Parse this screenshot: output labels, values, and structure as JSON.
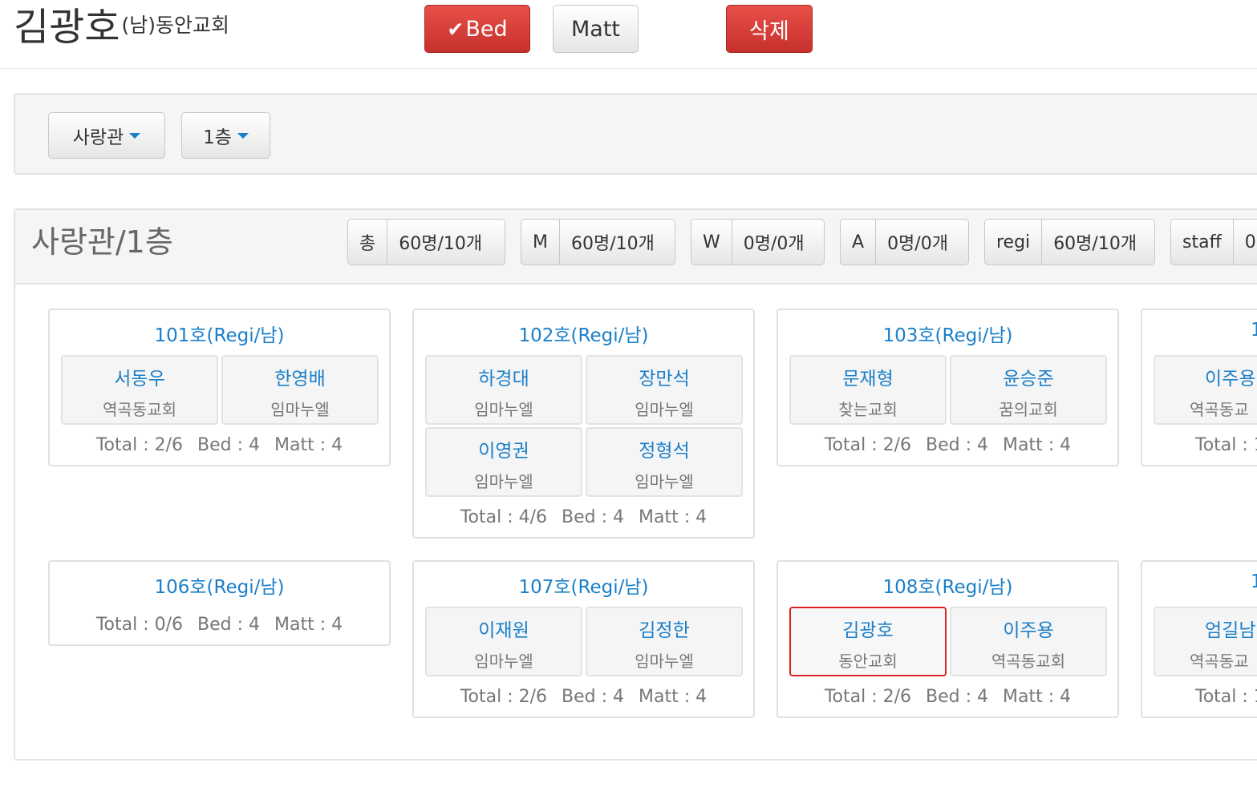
{
  "header": {
    "name": "김광호",
    "sub": "(남)동안교회",
    "bed_button": "Bed",
    "matt_button": "Matt",
    "delete_button": "삭제"
  },
  "filters": {
    "building": "사랑관",
    "floor": "1층"
  },
  "panel": {
    "title": "사랑관/1층",
    "stats": [
      {
        "key": "총",
        "value": "60명/10개"
      },
      {
        "key": "M",
        "value": "60명/10개"
      },
      {
        "key": "W",
        "value": "0명/0개"
      },
      {
        "key": "A",
        "value": "0명/0개"
      },
      {
        "key": "regi",
        "value": "60명/10개"
      },
      {
        "key": "staff",
        "value": "0"
      }
    ]
  },
  "rooms": [
    {
      "title": "101호(Regi/남)",
      "people": [
        {
          "name": "서동우",
          "church": "역곡동교회"
        },
        {
          "name": "한영배",
          "church": "임마누엘"
        }
      ],
      "total": "Total : 2/6",
      "bed": "Bed : 4",
      "matt": "Matt : 4"
    },
    {
      "title": "102호(Regi/남)",
      "people": [
        {
          "name": "하경대",
          "church": "임마누엘"
        },
        {
          "name": "장만석",
          "church": "임마누엘"
        },
        {
          "name": "이영권",
          "church": "임마누엘"
        },
        {
          "name": "정형석",
          "church": "임마누엘"
        }
      ],
      "total": "Total : 4/6",
      "bed": "Bed : 4",
      "matt": "Matt : 4"
    },
    {
      "title": "103호(Regi/남)",
      "people": [
        {
          "name": "문재형",
          "church": "찾는교회"
        },
        {
          "name": "윤승준",
          "church": "꿈의교회"
        }
      ],
      "total": "Total : 2/6",
      "bed": "Bed : 4",
      "matt": "Matt : 4"
    },
    {
      "title": "1",
      "people": [
        {
          "name": "이주용",
          "church": "역곡동교"
        }
      ],
      "total": "Total : 1",
      "bed": "",
      "matt": ""
    },
    {
      "title": "106호(Regi/남)",
      "people": [],
      "total": "Total : 0/6",
      "bed": "Bed : 4",
      "matt": "Matt : 4"
    },
    {
      "title": "107호(Regi/남)",
      "people": [
        {
          "name": "이재원",
          "church": "임마누엘"
        },
        {
          "name": "김정한",
          "church": "임마누엘"
        }
      ],
      "total": "Total : 2/6",
      "bed": "Bed : 4",
      "matt": "Matt : 4"
    },
    {
      "title": "108호(Regi/남)",
      "people": [
        {
          "name": "김광호",
          "church": "동안교회",
          "selected": true
        },
        {
          "name": "이주용",
          "church": "역곡동교회"
        }
      ],
      "total": "Total : 2/6",
      "bed": "Bed : 4",
      "matt": "Matt : 4"
    },
    {
      "title": "1",
      "people": [
        {
          "name": "엄길남",
          "church": "역곡동교"
        }
      ],
      "total": "Total : 1",
      "bed": "",
      "matt": ""
    }
  ],
  "colors": {
    "accent": "#1a7fc9",
    "danger": "#d9403a",
    "selected_border": "#dd2222"
  }
}
